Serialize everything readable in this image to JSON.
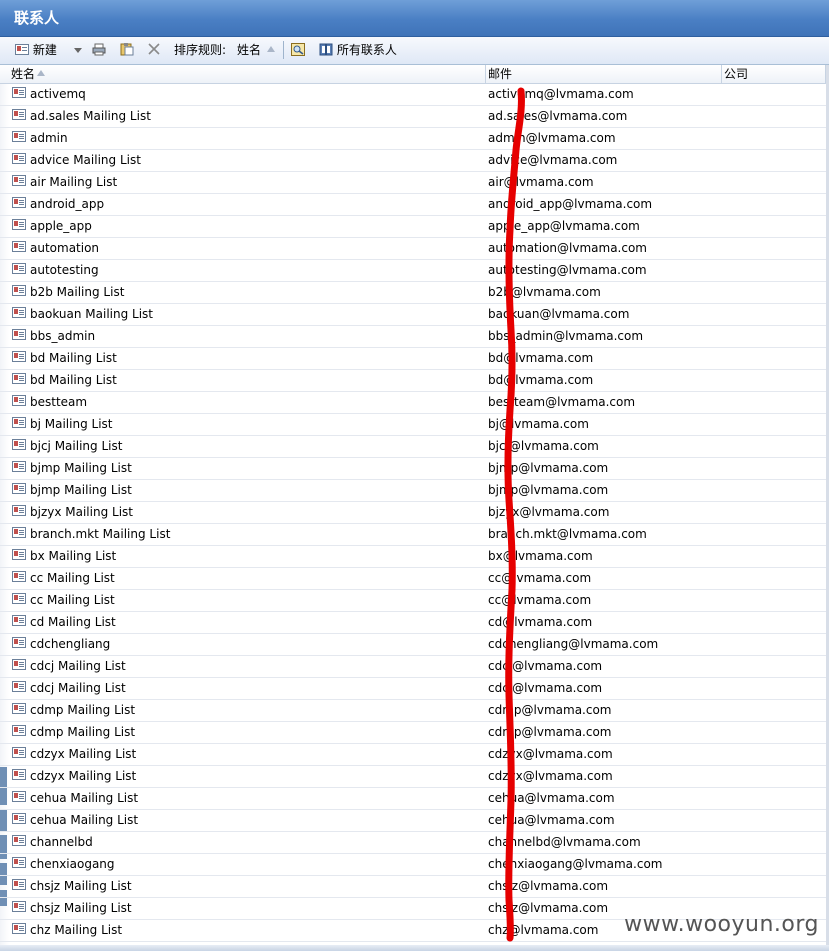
{
  "window": {
    "title": "联系人"
  },
  "toolbar": {
    "new_label": "新建",
    "sort_label": "排序规则:",
    "sort_value": "姓名",
    "all_contacts_label": "所有联系人"
  },
  "columns": {
    "name": "姓名",
    "email": "邮件",
    "company": "公司"
  },
  "contacts": [
    {
      "name": "activemq",
      "email": "activemq@lvmama.com"
    },
    {
      "name": "ad.sales Mailing List",
      "email": "ad.sales@lvmama.com"
    },
    {
      "name": "admin",
      "email": "admin@lvmama.com"
    },
    {
      "name": "advice Mailing List",
      "email": "advice@lvmama.com"
    },
    {
      "name": "air Mailing List",
      "email": "air@lvmama.com"
    },
    {
      "name": "android_app",
      "email": "android_app@lvmama.com"
    },
    {
      "name": "apple_app",
      "email": "apple_app@lvmama.com"
    },
    {
      "name": "automation",
      "email": "automation@lvmama.com"
    },
    {
      "name": "autotesting",
      "email": "autotesting@lvmama.com"
    },
    {
      "name": "b2b Mailing List",
      "email": "b2b@lvmama.com"
    },
    {
      "name": "baokuan Mailing List",
      "email": "baokuan@lvmama.com"
    },
    {
      "name": "bbs_admin",
      "email": "bbs_admin@lvmama.com"
    },
    {
      "name": "bd Mailing List",
      "email": "bd@lvmama.com"
    },
    {
      "name": "bd Mailing List",
      "email": "bd@lvmama.com"
    },
    {
      "name": "bestteam",
      "email": "bestteam@lvmama.com"
    },
    {
      "name": "bj Mailing List",
      "email": "bj@lvmama.com"
    },
    {
      "name": "bjcj Mailing List",
      "email": "bjcj@lvmama.com"
    },
    {
      "name": "bjmp Mailing List",
      "email": "bjmp@lvmama.com"
    },
    {
      "name": "bjmp Mailing List",
      "email": "bjmp@lvmama.com"
    },
    {
      "name": "bjzyx Mailing List",
      "email": "bjzyx@lvmama.com"
    },
    {
      "name": "branch.mkt Mailing List",
      "email": "branch.mkt@lvmama.com"
    },
    {
      "name": "bx Mailing List",
      "email": "bx@lvmama.com"
    },
    {
      "name": "cc Mailing List",
      "email": "cc@lvmama.com"
    },
    {
      "name": "cc Mailing List",
      "email": "cc@lvmama.com"
    },
    {
      "name": "cd Mailing List",
      "email": "cd@lvmama.com"
    },
    {
      "name": "cdchengliang",
      "email": "cdchengliang@lvmama.com"
    },
    {
      "name": "cdcj Mailing List",
      "email": "cdcj@lvmama.com"
    },
    {
      "name": "cdcj Mailing List",
      "email": "cdcj@lvmama.com"
    },
    {
      "name": "cdmp Mailing List",
      "email": "cdmp@lvmama.com"
    },
    {
      "name": "cdmp Mailing List",
      "email": "cdmp@lvmama.com"
    },
    {
      "name": "cdzyx Mailing List",
      "email": "cdzyx@lvmama.com"
    },
    {
      "name": "cdzyx Mailing List",
      "email": "cdzyx@lvmama.com"
    },
    {
      "name": "cehua Mailing List",
      "email": "cehua@lvmama.com"
    },
    {
      "name": "cehua Mailing List",
      "email": "cehua@lvmama.com"
    },
    {
      "name": "channelbd",
      "email": "channelbd@lvmama.com"
    },
    {
      "name": "chenxiaogang",
      "email": "chenxiaogang@lvmama.com"
    },
    {
      "name": "chsjz Mailing List",
      "email": "chsjz@lvmama.com"
    },
    {
      "name": "chsjz Mailing List",
      "email": "chsjz@lvmama.com"
    },
    {
      "name": "chz Mailing List",
      "email": "chz@lvmama.com"
    }
  ],
  "watermark": "www.wooyun.org",
  "colors": {
    "title_bar": "#4a7fc4",
    "annotation_red": "#e60000"
  }
}
